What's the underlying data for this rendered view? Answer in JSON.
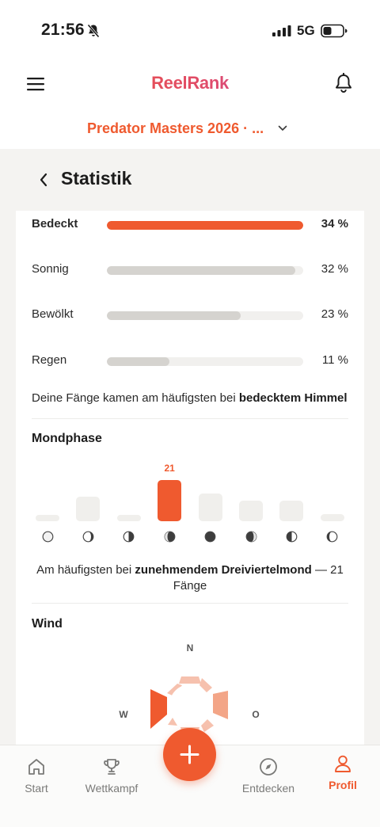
{
  "status_bar": {
    "time": "21:56",
    "network": "5G"
  },
  "header": {
    "logo": "ReelRank",
    "tournament": "Predator Masters 2026 · ..."
  },
  "card": {
    "title": "Statistik"
  },
  "weather": {
    "rows": [
      {
        "label": "Bedeckt",
        "percent": "34 %",
        "fraction": 1.0,
        "top": true
      },
      {
        "label": "Sonnig",
        "percent": "32 %",
        "fraction": 0.96,
        "top": false
      },
      {
        "label": "Bewölkt",
        "percent": "23 %",
        "fraction": 0.68,
        "top": false
      },
      {
        "label": "Regen",
        "percent": "11 %",
        "fraction": 0.32,
        "top": false
      }
    ],
    "summary_prefix": "Deine Fänge kamen am häufigsten bei ",
    "summary_bold": "bedecktem Himmel"
  },
  "moon": {
    "title": "Mondphase",
    "max_value": "21",
    "bars": [
      0.14,
      0.6,
      0.1,
      1.0,
      0.68,
      0.5,
      0.5,
      0.18
    ],
    "icons": [
      "new-moon-icon",
      "waxing-crescent-icon",
      "first-quarter-icon",
      "waxing-gibbous-icon",
      "full-moon-icon",
      "waning-gibbous-icon",
      "last-quarter-icon",
      "waning-crescent-icon"
    ],
    "summary_prefix": "Am häufigsten bei ",
    "summary_bold": "zunehmendem Dreiviertelmond",
    "summary_suffix": " — 21 Fänge"
  },
  "wind": {
    "title": "Wind",
    "north": "N",
    "west": "W",
    "east": "O"
  },
  "nav": {
    "items": [
      {
        "label": "Start",
        "icon": "home-icon"
      },
      {
        "label": "Wettkampf",
        "icon": "trophy-icon"
      },
      {
        "label": "Entdecken",
        "icon": "compass-icon"
      },
      {
        "label": "Profil",
        "icon": "profile-icon",
        "active": true
      }
    ]
  },
  "colors": {
    "accent": "#ef5a2f",
    "bar_muted": "#d5d3cf",
    "track": "#f1f0ee"
  }
}
